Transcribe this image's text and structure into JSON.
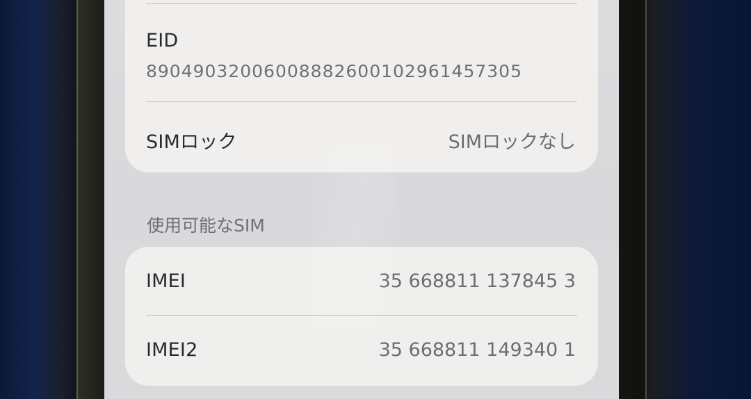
{
  "rows": {
    "eid": {
      "label": "EID",
      "value": "89049032006008882600102961457305"
    },
    "sim_lock": {
      "label": "SIMロック",
      "value": "SIMロックなし"
    }
  },
  "available_sim": {
    "header": "使用可能なSIM",
    "imei": {
      "label": "IMEI",
      "value": "35 668811 137845 3"
    },
    "imei2": {
      "label": "IMEI2",
      "value": "35 668811 149340 1"
    }
  }
}
